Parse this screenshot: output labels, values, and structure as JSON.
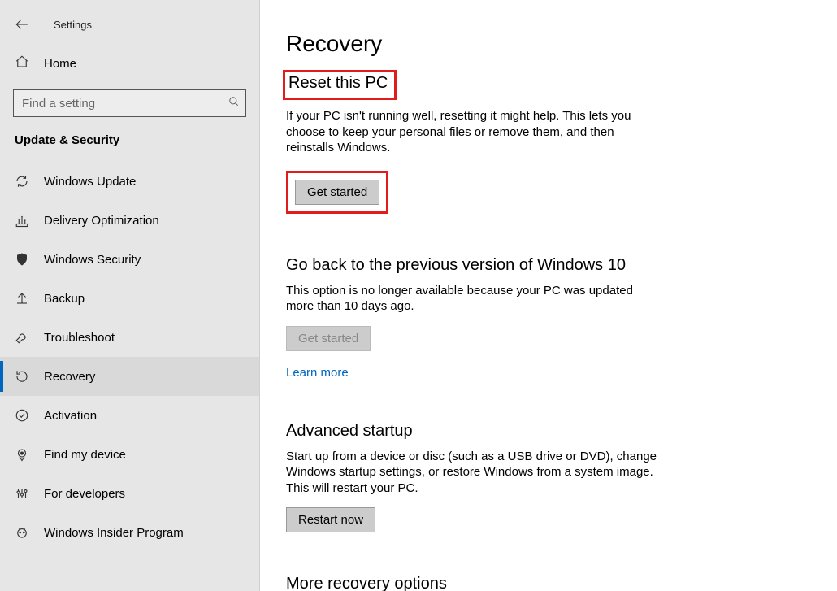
{
  "app_title": "Settings",
  "home_label": "Home",
  "search": {
    "placeholder": "Find a setting"
  },
  "category_title": "Update & Security",
  "nav": {
    "items": [
      {
        "label": "Windows Update"
      },
      {
        "label": "Delivery Optimization"
      },
      {
        "label": "Windows Security"
      },
      {
        "label": "Backup"
      },
      {
        "label": "Troubleshoot"
      },
      {
        "label": "Recovery"
      },
      {
        "label": "Activation"
      },
      {
        "label": "Find my device"
      },
      {
        "label": "For developers"
      },
      {
        "label": "Windows Insider Program"
      }
    ]
  },
  "page": {
    "title": "Recovery",
    "reset": {
      "title": "Reset this PC",
      "body": "If your PC isn't running well, resetting it might help. This lets you choose to keep your personal files or remove them, and then reinstalls Windows.",
      "button": "Get started"
    },
    "goback": {
      "title": "Go back to the previous version of Windows 10",
      "body": "This option is no longer available because your PC was updated more than 10 days ago.",
      "button": "Get started",
      "learn_more": "Learn more"
    },
    "advanced": {
      "title": "Advanced startup",
      "body": "Start up from a device or disc (such as a USB drive or DVD), change Windows startup settings, or restore Windows from a system image. This will restart your PC.",
      "button": "Restart now"
    },
    "more": {
      "title": "More recovery options"
    }
  }
}
